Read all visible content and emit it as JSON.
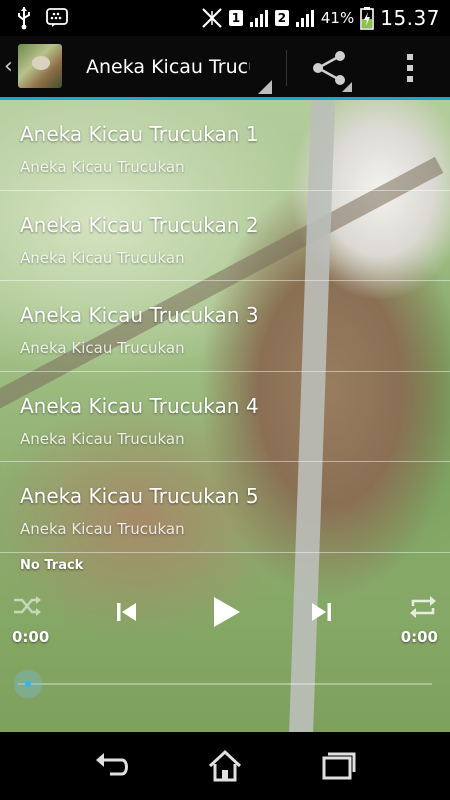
{
  "status_bar": {
    "sim1_label": "1",
    "sim2_label": "2",
    "battery_percent": "41%",
    "time": "15.37",
    "icons": [
      "usb-icon",
      "bbm-icon",
      "no-signal-icon",
      "signal-icon",
      "battery-charging-icon"
    ]
  },
  "action_bar": {
    "title": "Aneka Kicau Trucukan",
    "up_glyph": "‹",
    "icons": [
      "app-icon",
      "share-icon",
      "overflow-menu-icon"
    ]
  },
  "tracks": [
    {
      "title": "Aneka Kicau Trucukan 1",
      "subtitle": "Aneka Kicau Trucukan"
    },
    {
      "title": "Aneka Kicau Trucukan 2",
      "subtitle": "Aneka Kicau Trucukan"
    },
    {
      "title": "Aneka Kicau Trucukan 3",
      "subtitle": "Aneka Kicau Trucukan"
    },
    {
      "title": "Aneka Kicau Trucukan 4",
      "subtitle": "Aneka Kicau Trucukan"
    },
    {
      "title": "Aneka Kicau Trucukan 5",
      "subtitle": "Aneka Kicau Trucukan"
    }
  ],
  "player": {
    "now_playing": "No Track",
    "elapsed": "0:00",
    "total": "0:00",
    "progress_fraction": 0,
    "icons": [
      "shuffle-icon",
      "previous-icon",
      "play-icon",
      "next-icon",
      "repeat-icon"
    ]
  },
  "nav_bar": {
    "icons": [
      "back-icon",
      "home-icon",
      "recent-apps-icon"
    ]
  },
  "colors": {
    "accent": "#1ea6c9",
    "seek_thumb": "#33b5e5"
  }
}
